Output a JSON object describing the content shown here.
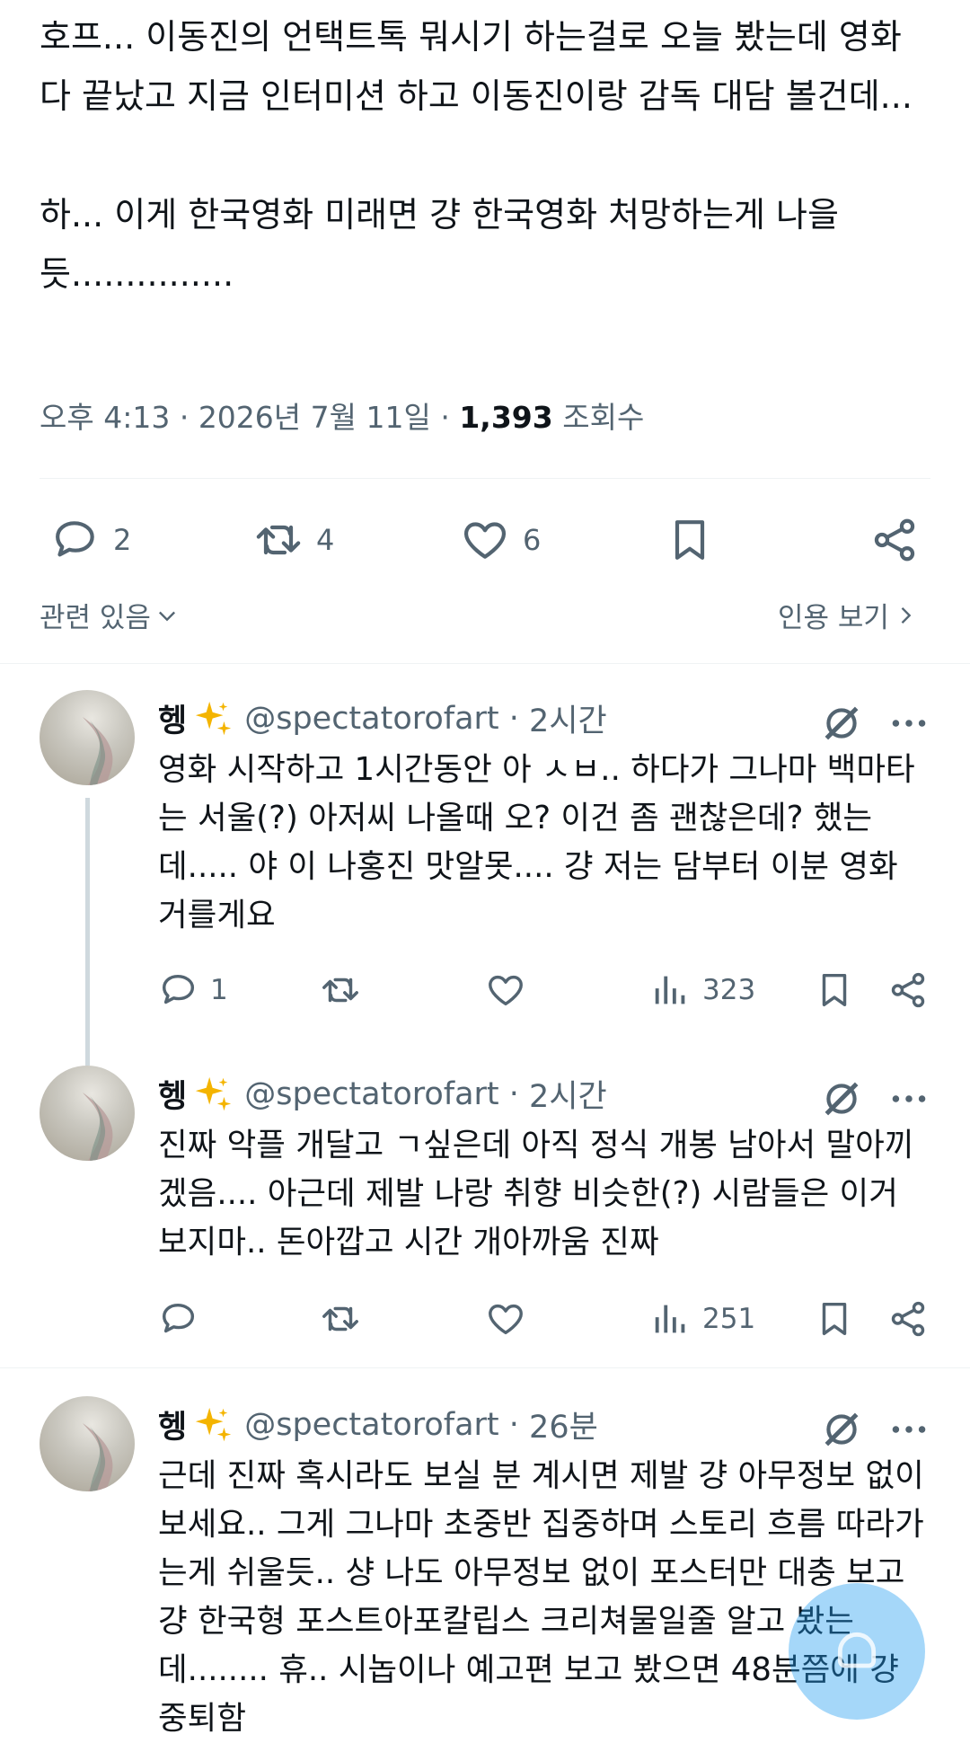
{
  "tweet": {
    "text": "호프... 이동진의 언택트톡 뭐시기 하는걸로 오늘 봤는데 영화 다 끝났고 지금 인터미션 하고 이동진이랑 감독 대담 볼건데...\n\n하... 이게 한국영화 미래면 걍 한국영화 처망하는게 나을듯...............",
    "time": "오후 4:13",
    "date": "2026년 7월 11일",
    "views_count": "1,393",
    "views_label": "조회수",
    "replies": "2",
    "retweets": "4",
    "likes": "6",
    "related_label": "관련 있음",
    "quote_label": "인용 보기"
  },
  "replies": [
    {
      "name": "헹",
      "handle": "@spectatorofart",
      "time": "2시간",
      "text": "영화 시작하고 1시간동안 아 ㅅㅂ.. 하다가 그나마 백마타는 서울(?) 아저씨 나올때 오? 이건 좀 괜찮은데? 했는데..... 야 이 나홍진 맛알못.... 걍 저는 담부터 이분 영화 거를게요",
      "replies": "1",
      "retweets": "",
      "likes": "",
      "views": "323"
    },
    {
      "name": "헹",
      "handle": "@spectatorofart",
      "time": "2시간",
      "text": "진짜 악플 개달고 ㄱ싶은데 아직 정식 개봉 남아서 말아끼겠음.... 아근데 제발 나랑 취향 비슷한(?) 시람들은 이거 보지마.. 돈아깝고 시간 개아까움 진짜",
      "replies": "",
      "retweets": "",
      "likes": "",
      "views": "251"
    },
    {
      "name": "헹",
      "handle": "@spectatorofart",
      "time": "26분",
      "text": "근데 진짜 혹시라도 보실 분 계시면 제발 걍 아무정보 없이 보세요.. 그게 그나마 초중반 집중하며 스토리 흐름 따라가는게 쉬울듯.. 샹 나도 아무정보 없이 포스터만 대충 보고 걍 한국형 포스트아포칼립스 크리쳐물일줄 알고 봤는데........ 휴.. 시놉이나 예고편 보고 봤으면 48분쯤에 걍 중퇴함"
    }
  ],
  "icons": {
    "reply": "speech-bubble-icon",
    "retweet": "retweet-icon",
    "like": "heart-icon",
    "bookmark": "bookmark-icon",
    "share": "share-icon",
    "views": "bar-chart-icon",
    "grok": "grok-icon",
    "more": "more-dots-icon",
    "sparkle": "sparkles-emoji",
    "fab": "compose-fab"
  },
  "colors": {
    "text": "#0f1419",
    "secondary": "#536471",
    "divider": "#eff3f4",
    "fab": "#1d9bf0"
  }
}
